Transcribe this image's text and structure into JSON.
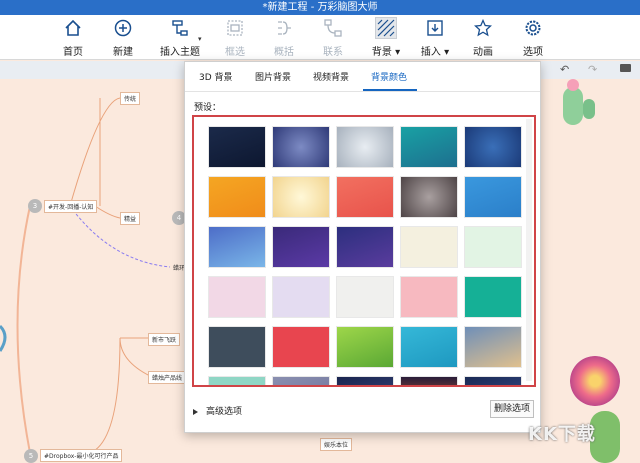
{
  "window": {
    "title": "*新建工程 - 万彩脑图大师"
  },
  "toolbar": {
    "home": "首页",
    "new": "新建",
    "insert_topic": "插入主题",
    "frame_select": "框选",
    "summary": "概括",
    "relation": "联系",
    "background": "背景",
    "insert": "插入",
    "animation": "动画",
    "options": "选项"
  },
  "mindmap": {
    "n1": "传统",
    "n2": "#开发-回播-认知",
    "n3": "精益",
    "n4": "新市飞跃",
    "n5": "蜡烛产品线",
    "n6": "#Dropbox-最小化可行产品",
    "n7": "娱乐本位",
    "n8": "蜡环",
    "badge3": "3",
    "badge4": "4",
    "badge5": "5"
  },
  "dialog": {
    "tabs": [
      "3D 背景",
      "图片背景",
      "视频背景",
      "背景颜色"
    ],
    "active_tab": 3,
    "preset_label": "预设：",
    "advanced": "高级选项",
    "delete_option": "删除选项"
  },
  "swatches": [
    "linear-gradient(160deg,#1b2a4a,#0d1730)",
    "radial-gradient(circle,#7d8bc4,#2f3a78)",
    "radial-gradient(circle,#e8edf2,#a7b1bd)",
    "linear-gradient(160deg,#19a1a4,#1d6f8f)",
    "radial-gradient(circle,#3a6fb8,#1b3a78)",
    "linear-gradient(160deg,#f5a623,#f08c1a)",
    "radial-gradient(circle,#fff8d8,#f2d48e)",
    "linear-gradient(160deg,#f27060,#e8534b)",
    "radial-gradient(circle,#a9a0a0,#4e4446)",
    "linear-gradient(160deg,#3a98de,#2b7fc9)",
    "linear-gradient(160deg,#4d6dc8,#7ab6e8)",
    "linear-gradient(160deg,#3a2a7a,#5b3aa6)",
    "linear-gradient(160deg,#2c2f7e,#5a3c9e)",
    "#f4f0df",
    "#e2f4e4",
    "#f2d8e6",
    "#e4dcf1",
    "#f0f0ee",
    "#f7b9c0",
    "#15b096",
    "#3e4d5c",
    "#e8454f",
    "linear-gradient(160deg,#9ed64a,#5aa834)",
    "linear-gradient(160deg,#35b8d8,#1e98c0)",
    "linear-gradient(160deg,#6f8fb8,#e0c08e)",
    "#8fd6c5",
    "linear-gradient(160deg,#8a8fb0,#6a6f98)",
    "linear-gradient(160deg,#1a2550,#3a4a80)",
    "linear-gradient(180deg,#2a1d3a,#e06a2a)",
    "linear-gradient(160deg,#1a2a55,#3a5090)"
  ],
  "watermark": {
    "text": "KK下载"
  }
}
